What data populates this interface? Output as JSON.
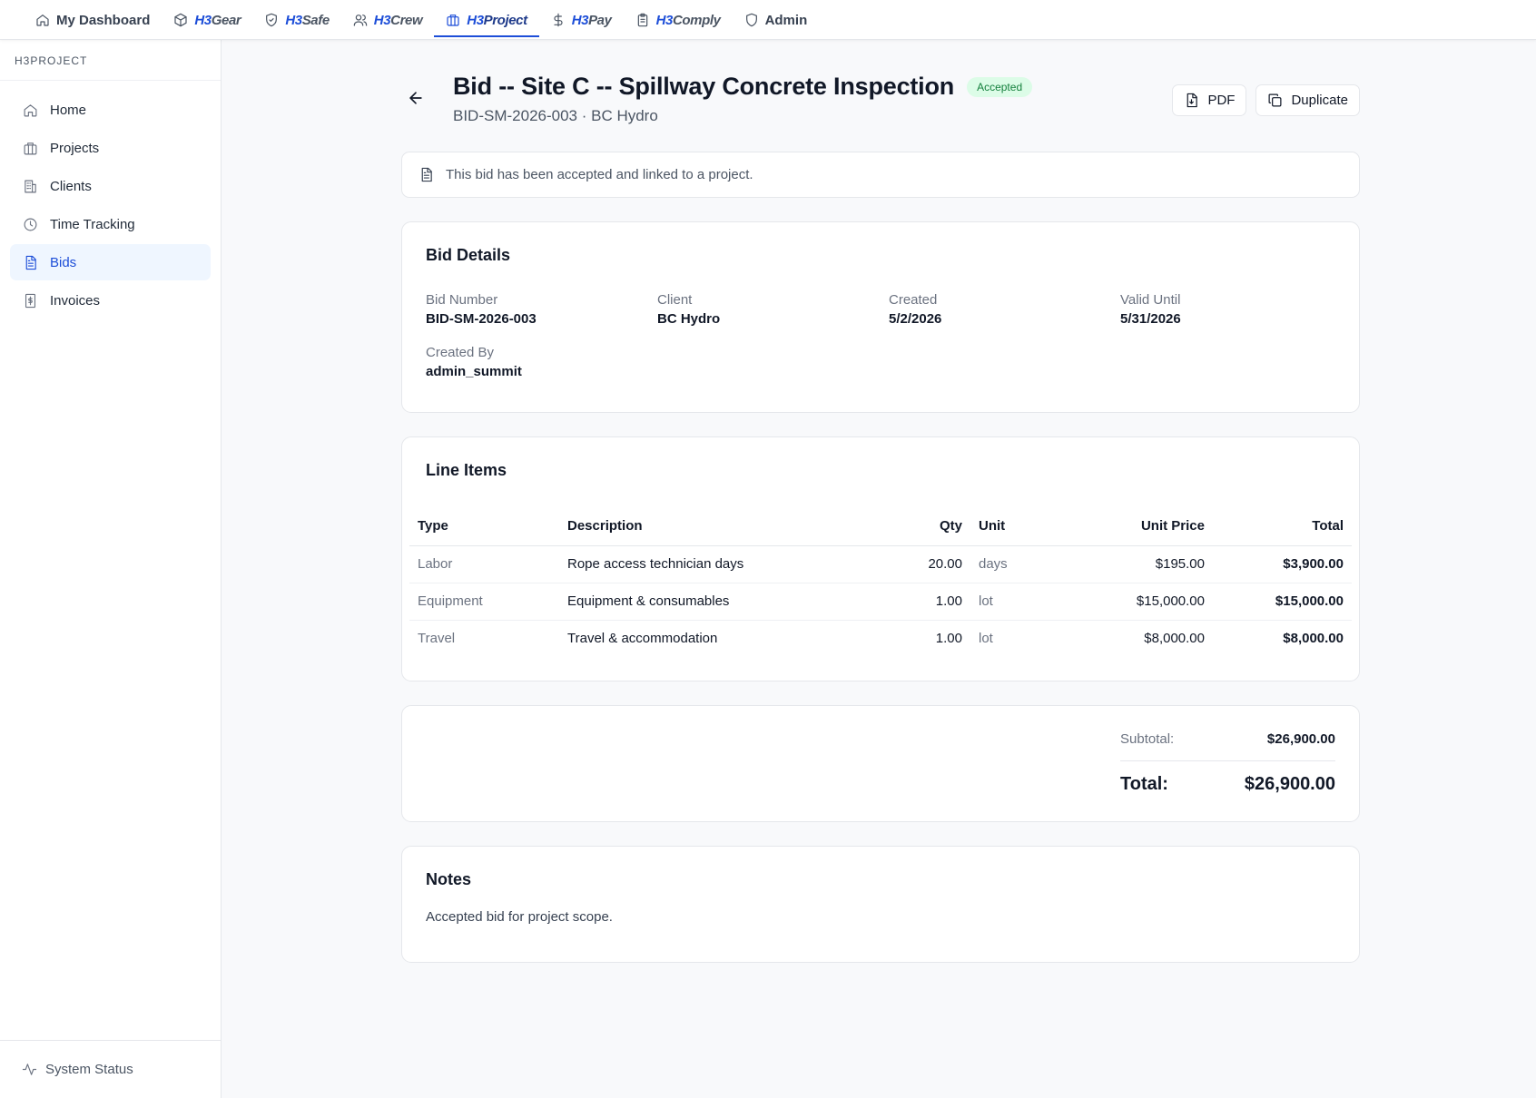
{
  "topnav": {
    "items": [
      {
        "label": "My Dashboard"
      },
      {
        "h3": "H3",
        "rest": "Gear"
      },
      {
        "h3": "H3",
        "rest": "Safe"
      },
      {
        "h3": "H3",
        "rest": "Crew"
      },
      {
        "h3": "H3",
        "rest": "Project"
      },
      {
        "h3": "H3",
        "rest": "Pay"
      },
      {
        "h3": "H3",
        "rest": "Comply"
      },
      {
        "label": "Admin"
      }
    ],
    "accent": "#1d4ed8"
  },
  "sidebar": {
    "header": "H3PROJECT",
    "items": [
      {
        "label": "Home"
      },
      {
        "label": "Projects"
      },
      {
        "label": "Clients"
      },
      {
        "label": "Time Tracking"
      },
      {
        "label": "Bids"
      },
      {
        "label": "Invoices"
      }
    ],
    "footer": "System Status"
  },
  "page": {
    "title": "Bid -- Site C -- Spillway Concrete Inspection",
    "status": "Accepted",
    "subtitle": "BID-SM-2026-003 · BC Hydro",
    "pdf_label": "PDF",
    "duplicate_label": "Duplicate",
    "banner": "This bid has been accepted and linked to a project."
  },
  "details": {
    "title": "Bid Details",
    "fields": [
      {
        "label": "Bid Number",
        "value": "BID-SM-2026-003"
      },
      {
        "label": "Client",
        "value": "BC Hydro"
      },
      {
        "label": "Created",
        "value": "5/2/2026"
      },
      {
        "label": "Valid Until",
        "value": "5/31/2026"
      },
      {
        "label": "Created By",
        "value": "admin_summit"
      }
    ]
  },
  "line_items": {
    "title": "Line Items",
    "headers": {
      "type": "Type",
      "description": "Description",
      "qty": "Qty",
      "unit": "Unit",
      "unit_price": "Unit Price",
      "total": "Total"
    },
    "rows": [
      {
        "type": "Labor",
        "description": "Rope access technician days",
        "qty": "20.00",
        "unit": "days",
        "unit_price": "$195.00",
        "total": "$3,900.00"
      },
      {
        "type": "Equipment",
        "description": "Equipment & consumables",
        "qty": "1.00",
        "unit": "lot",
        "unit_price": "$15,000.00",
        "total": "$15,000.00"
      },
      {
        "type": "Travel",
        "description": "Travel & accommodation",
        "qty": "1.00",
        "unit": "lot",
        "unit_price": "$8,000.00",
        "total": "$8,000.00"
      }
    ]
  },
  "totals": {
    "subtotal_label": "Subtotal:",
    "subtotal": "$26,900.00",
    "total_label": "Total:",
    "total": "$26,900.00"
  },
  "notes": {
    "title": "Notes",
    "text": "Accepted bid for project scope."
  }
}
